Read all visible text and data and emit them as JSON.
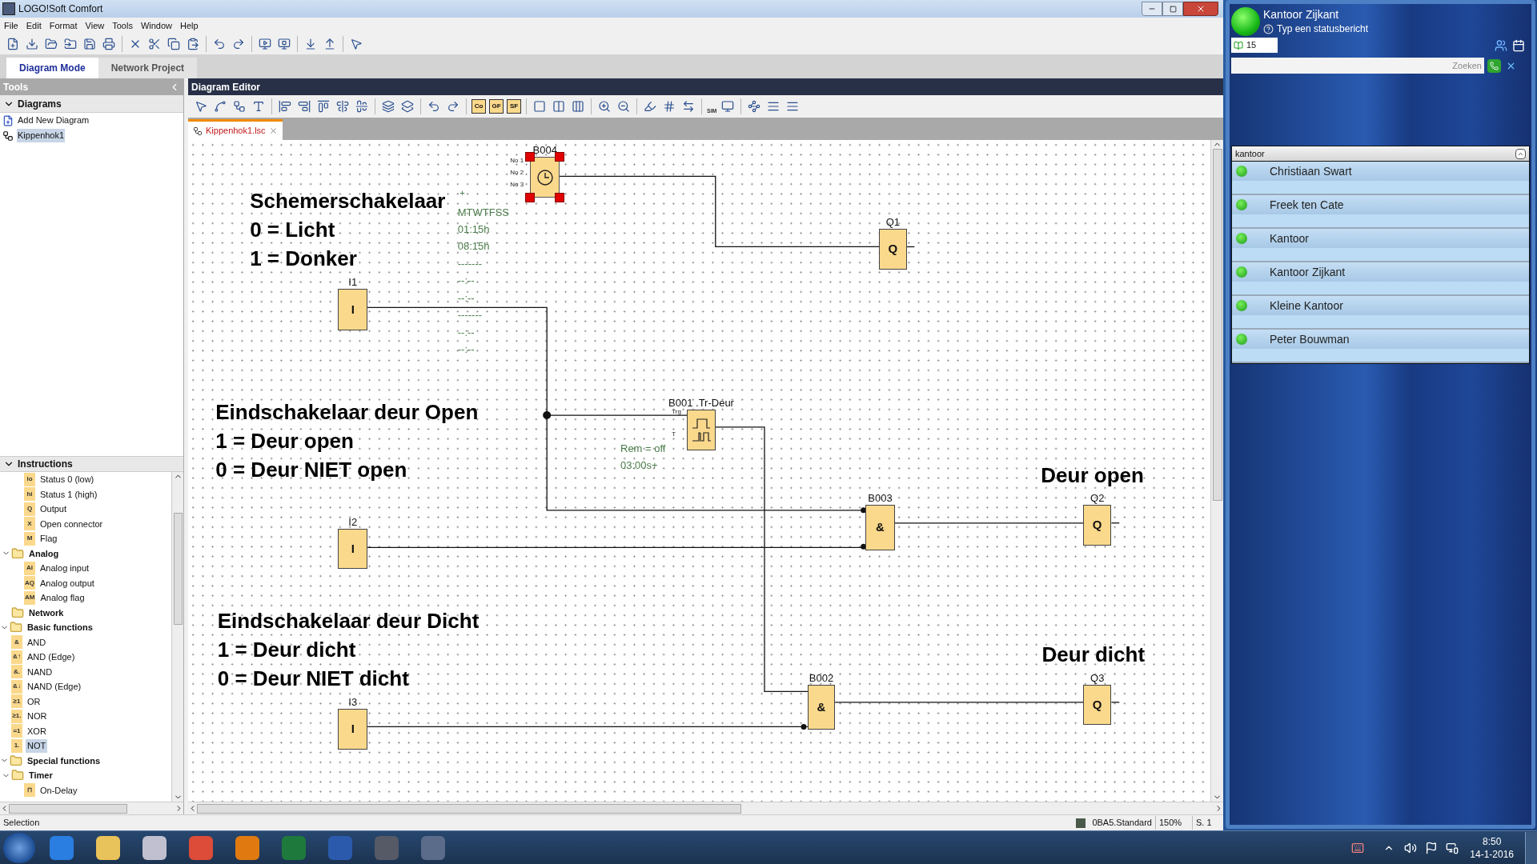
{
  "window": {
    "title": "LOGO!Soft Comfort"
  },
  "menu": [
    "File",
    "Edit",
    "Format",
    "View",
    "Tools",
    "Window",
    "Help"
  ],
  "mode_tabs": [
    {
      "label": "Diagram Mode",
      "selected": true
    },
    {
      "label": "Network Project",
      "selected": false
    }
  ],
  "tools_panel": {
    "title": "Tools",
    "diagrams": {
      "title": "Diagrams",
      "expanded": true,
      "items": [
        {
          "label": "Add New Diagram",
          "kind": "add",
          "selected": false
        },
        {
          "label": "Kippenhok1",
          "kind": "diagram",
          "selected": true
        }
      ]
    },
    "instructions": {
      "title": "Instructions",
      "expanded": true,
      "tree": [
        {
          "children": [
            {
              "children": [
                {
                  "label": "Status 0 (low)",
                  "badge": "lo",
                  "selected": false
                },
                {
                  "label": "Status 1 (high)",
                  "badge": "hi",
                  "selected": false
                },
                {
                  "label": "Output",
                  "badge": "Q",
                  "selected": false
                },
                {
                  "label": "Open connector",
                  "badge": "X",
                  "selected": false
                },
                {
                  "label": "Flag",
                  "badge": "M",
                  "selected": false
                }
              ]
            },
            {
              "label": "Analog",
              "expanded": true,
              "selected": false,
              "children": [
                {
                  "label": "Analog input",
                  "badge": "AI",
                  "selected": false
                },
                {
                  "label": "Analog output",
                  "badge": "AQ",
                  "selected": false
                },
                {
                  "label": "Analog flag",
                  "badge": "AM",
                  "selected": false
                }
              ]
            },
            {
              "label": "Network",
              "expanded": false,
              "selected": false
            }
          ]
        },
        {
          "label": "Basic functions",
          "expanded": true,
          "selected": false,
          "children": [
            {
              "label": "AND",
              "badge": "&",
              "selected": false
            },
            {
              "label": "AND (Edge)",
              "badge": "&↑",
              "selected": false
            },
            {
              "label": "NAND",
              "badge": "&.",
              "selected": false
            },
            {
              "label": "NAND (Edge)",
              "badge": "&↓",
              "selected": false
            },
            {
              "label": "OR",
              "badge": "≥1",
              "selected": false
            },
            {
              "label": "NOR",
              "badge": "≥1.",
              "selected": false
            },
            {
              "label": "XOR",
              "badge": "=1",
              "selected": false
            },
            {
              "label": "NOT",
              "badge": "1.",
              "selected": true
            }
          ]
        },
        {
          "label": "Special functions",
          "expanded": true,
          "selected": false,
          "children": [
            {
              "label": "Timer",
              "expanded": true,
              "selected": false,
              "children": [
                {
                  "label": "On-Delay",
                  "badge": "⊓",
                  "selected": false
                }
              ]
            }
          ]
        }
      ]
    }
  },
  "editor": {
    "title": "Diagram Editor",
    "text_buttons": [
      "Co",
      "GF",
      "SF"
    ],
    "sim_label": "SIM",
    "tabs": [
      {
        "label": "Kippenhok1.lsc",
        "selected": true
      }
    ],
    "comments": [
      {
        "lines": [
          "Schemerschakelaar",
          "0 = Licht",
          "1 = Donker"
        ]
      },
      {
        "lines": [
          "Eindschakelaar deur Open",
          "1 = Deur open",
          "0 = Deur NIET open"
        ]
      },
      {
        "lines": [
          "Eindschakelaar deur Dicht",
          "1 = Deur dicht",
          "0 = Deur NIET dicht"
        ]
      },
      {
        "lines": [
          "Deur open"
        ]
      },
      {
        "lines": [
          "Deur dicht"
        ]
      }
    ],
    "blocks": [
      {
        "kind": "timer",
        "label": "B004",
        "pins": [
          "No 1",
          "No 2",
          "No 3"
        ],
        "selected": true,
        "params": [
          "MTWTFSS",
          "01:15h",
          "08:15h",
          "-------",
          "--:--",
          "--:--",
          "-------",
          "--:--",
          "--:--"
        ],
        "param_mark": "+"
      },
      {
        "kind": "output",
        "label": "Q1",
        "symbol": "Q",
        "selected": false
      },
      {
        "kind": "input",
        "label": "I1",
        "symbol": "I",
        "selected": false
      },
      {
        "kind": "pulse",
        "label": "B001 .Tr-Deur",
        "pins": [
          "Trg",
          "T"
        ],
        "selected": false,
        "params": [
          "Rem = off",
          "03:00s+"
        ]
      },
      {
        "kind": "gate",
        "label": "B003",
        "symbol": "&",
        "selected": false
      },
      {
        "kind": "output",
        "label": "Q2",
        "symbol": "Q",
        "selected": false
      },
      {
        "kind": "input",
        "label": "I2",
        "symbol": "I",
        "selected": false
      },
      {
        "kind": "gate",
        "label": "B002",
        "symbol": "&",
        "selected": false
      },
      {
        "kind": "output",
        "label": "Q3",
        "symbol": "Q",
        "selected": false
      },
      {
        "kind": "input",
        "label": "I3",
        "symbol": "I",
        "selected": false
      }
    ]
  },
  "status_bar": {
    "left": "Selection",
    "device": "0BA5.Standard",
    "zoom": "150%",
    "page": "S. 1"
  },
  "chat": {
    "name": "Kantoor Zijkant",
    "status": "Typ een statusbericht",
    "count": "15",
    "search_placeholder": "Zoeken",
    "group": "kantoor",
    "contacts": [
      {
        "name": "Christiaan Swart",
        "online": true
      },
      {
        "name": "Freek ten Cate",
        "online": true
      },
      {
        "name": "Kantoor",
        "online": true
      },
      {
        "name": "Kantoor Zijkant",
        "online": true
      },
      {
        "name": "Kleine Kantoor",
        "online": true
      },
      {
        "name": "Peter Bouwman",
        "online": true
      }
    ]
  },
  "taskbar": {
    "time": "8:50",
    "date": "14-1-2016"
  }
}
